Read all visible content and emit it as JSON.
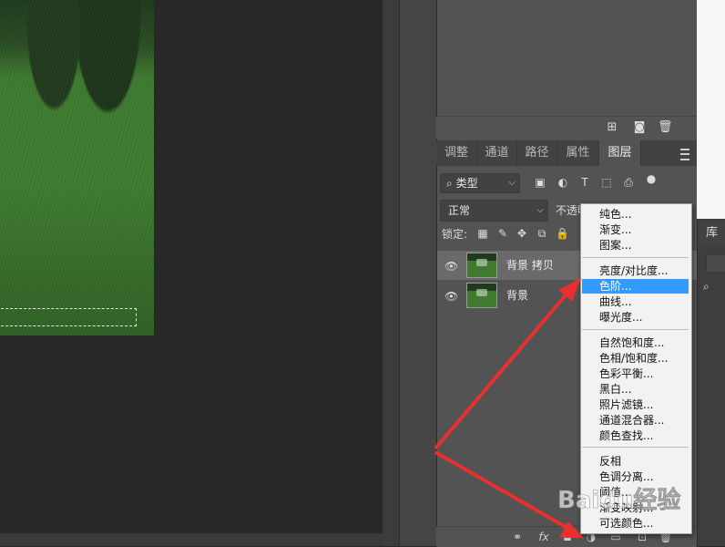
{
  "tabs": [
    "调整",
    "通道",
    "路径",
    "属性",
    "图层"
  ],
  "active_tab": "图层",
  "filter": {
    "kind_label": "类型"
  },
  "blend_mode": "正常",
  "opacity_label": "不透明",
  "lock_label": "锁定:",
  "layers": [
    {
      "name": "背景 拷贝",
      "visible": true,
      "selected": true
    },
    {
      "name": "背景",
      "visible": true,
      "selected": false
    }
  ],
  "library_tab": "库",
  "adjust_menu": {
    "group1": [
      "纯色...",
      "渐变...",
      "图案..."
    ],
    "group2": [
      "亮度/对比度...",
      "色阶...",
      "曲线...",
      "曝光度..."
    ],
    "group3": [
      "自然饱和度...",
      "色相/饱和度...",
      "色彩平衡...",
      "黑白...",
      "照片滤镜...",
      "通道混合器...",
      "颜色查找..."
    ],
    "group4": [
      "反相",
      "色调分离...",
      "阈值...",
      "渐变映射...",
      "可选颜色..."
    ],
    "highlighted": "色阶..."
  },
  "watermark": "Baidu经验",
  "icons": {
    "eye": "eye-icon",
    "annotation_color": "#e83030",
    "highlight_color": "#3399ff"
  }
}
